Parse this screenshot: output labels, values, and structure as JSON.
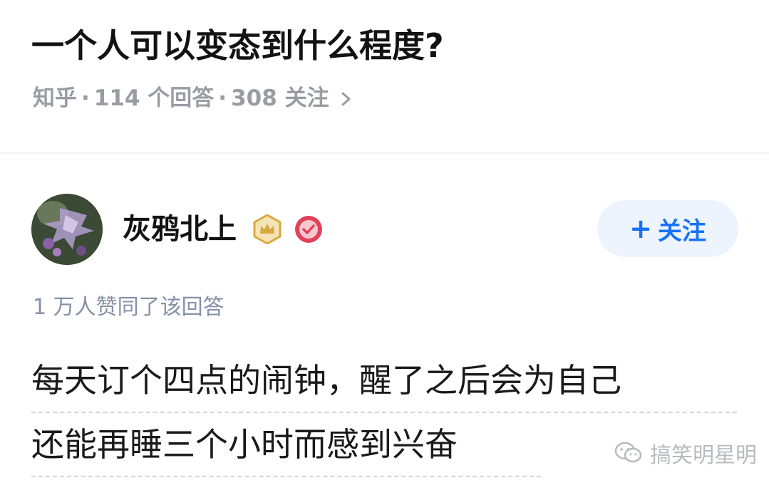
{
  "question": {
    "title": "一个人可以变态到什么程度?",
    "source": "知乎",
    "sep1": "·",
    "answers": "114 个回答",
    "sep2": "·",
    "follows": "308 关注",
    "chevron_icon": "chevron-right-icon"
  },
  "author": {
    "name": "灰鸦北上",
    "avatar_icon": "dragon-avatar",
    "badges": [
      "crown-badge-icon",
      "verified-badge-icon"
    ],
    "follow_plus": "+",
    "follow_label": "关注"
  },
  "answer": {
    "vote_summary": "1 万人赞同了该回答",
    "lines": [
      "每天订个四点的闹钟，醒了之后会为自己",
      "还能再睡三个小时而感到兴奋"
    ]
  },
  "watermark": {
    "icon": "wechat-icon",
    "text": "搞笑明星明"
  },
  "colors": {
    "follow_bg": "#edf4fd",
    "follow_text": "#1772f6",
    "meta_text": "#9a9ca3",
    "vote_text": "#8590a6",
    "crown_gold": "#d9a941",
    "verified_red": "#e0425a"
  }
}
